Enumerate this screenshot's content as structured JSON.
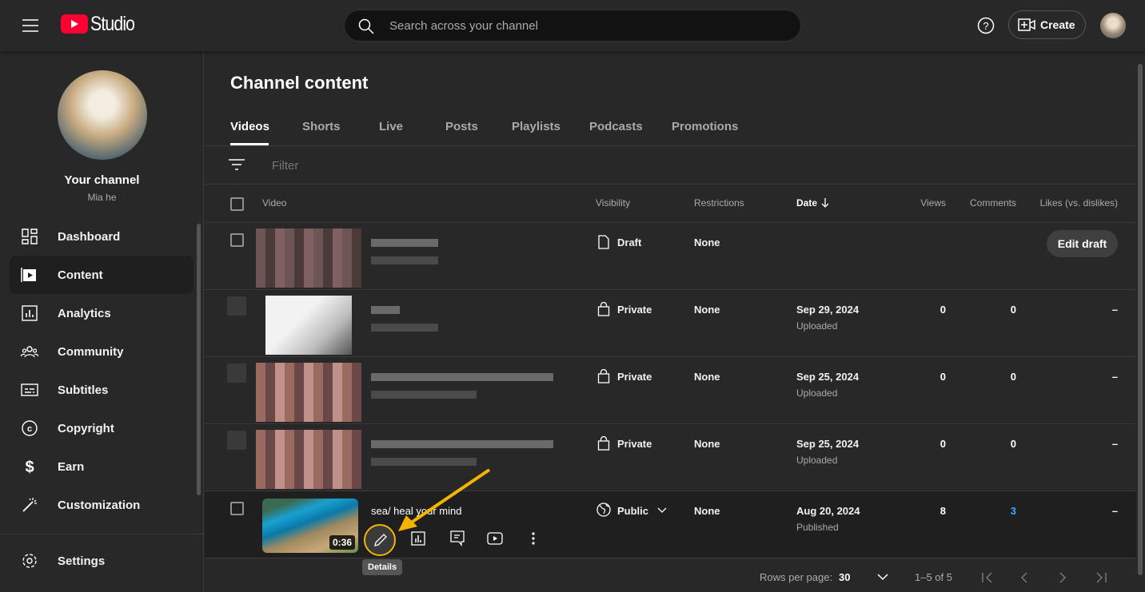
{
  "header": {
    "logo_text": "Studio",
    "search_placeholder": "Search across your channel",
    "create_label": "Create",
    "brand_color": "#ff0033"
  },
  "sidebar": {
    "channel_title": "Your channel",
    "channel_name": "Mia he",
    "items": [
      {
        "label": "Dashboard",
        "icon": "dashboard-icon"
      },
      {
        "label": "Content",
        "icon": "content-icon",
        "active": true
      },
      {
        "label": "Analytics",
        "icon": "analytics-icon"
      },
      {
        "label": "Community",
        "icon": "community-icon"
      },
      {
        "label": "Subtitles",
        "icon": "subtitles-icon"
      },
      {
        "label": "Copyright",
        "icon": "copyright-icon"
      },
      {
        "label": "Earn",
        "icon": "dollar-icon"
      },
      {
        "label": "Customization",
        "icon": "magic-wand-icon"
      },
      {
        "label": "Settings",
        "icon": "gear-icon"
      }
    ]
  },
  "main": {
    "title": "Channel content",
    "tabs": [
      "Videos",
      "Shorts",
      "Live",
      "Posts",
      "Playlists",
      "Podcasts",
      "Promotions"
    ],
    "filter_placeholder": "Filter",
    "columns": {
      "video": "Video",
      "visibility": "Visibility",
      "restrictions": "Restrictions",
      "date": "Date",
      "views": "Views",
      "comments": "Comments",
      "likes": "Likes (vs. dislikes)"
    },
    "rows": [
      {
        "visibility": "Draft",
        "restrictions": "None",
        "date": "",
        "status": "",
        "views": "",
        "comments": "",
        "likes": "",
        "action": "Edit draft"
      },
      {
        "visibility": "Private",
        "restrictions": "None",
        "date": "Sep 29, 2024",
        "status": "Uploaded",
        "views": "0",
        "comments": "0",
        "likes": "–"
      },
      {
        "visibility": "Private",
        "restrictions": "None",
        "date": "Sep 25, 2024",
        "status": "Uploaded",
        "views": "0",
        "comments": "0",
        "likes": "–"
      },
      {
        "visibility": "Private",
        "restrictions": "None",
        "date": "Sep 25, 2024",
        "status": "Uploaded",
        "views": "0",
        "comments": "0",
        "likes": "–"
      },
      {
        "title": "sea/ heal your mind",
        "duration": "0:36",
        "visibility": "Public",
        "restrictions": "None",
        "date": "Aug 20, 2024",
        "status": "Published",
        "views": "8",
        "comments": "3",
        "likes": "–"
      }
    ],
    "tooltip": "Details",
    "footer": {
      "rows_per_page_label": "Rows per page:",
      "rows_per_page": "30",
      "range": "1–5 of 5"
    }
  }
}
